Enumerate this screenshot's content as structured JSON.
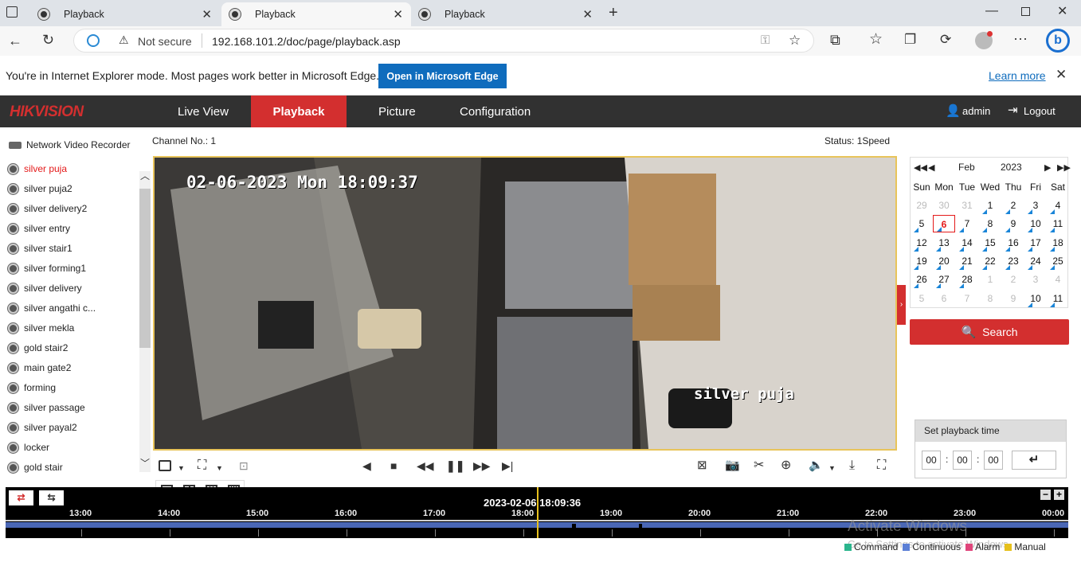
{
  "browser": {
    "tabs": [
      {
        "title": "Playback",
        "active": false
      },
      {
        "title": "Playback",
        "active": true
      },
      {
        "title": "Playback",
        "active": false
      }
    ],
    "security_label": "Not secure",
    "url": "192.168.101.2/doc/page/playback.asp",
    "ie_message": "You're in Internet Explorer mode. Most pages work better in Microsoft Edge.",
    "open_edge_label": "Open in Microsoft Edge",
    "learn_more_label": "Learn more"
  },
  "app": {
    "logo": "HIKVISION",
    "nav": [
      "Live View",
      "Playback",
      "Picture",
      "Configuration"
    ],
    "active_nav": "Playback",
    "user": "admin",
    "logout_label": "Logout"
  },
  "sidebar": {
    "title": "Network Video Recorder",
    "cameras": [
      "silver puja",
      "silver puja2",
      "silver delivery2",
      "silver entry",
      "silver stair1",
      "silver forming1",
      "silver delivery",
      "silver angathi c...",
      "silver mekla",
      "gold stair2",
      "main gate2",
      "forming",
      "silver passage",
      "silver payal2",
      "locker",
      "gold stair"
    ],
    "active_camera": "silver puja"
  },
  "player": {
    "channel": "Channel No.: 1",
    "status": "Status: 1Speed",
    "osd_time": "02-06-2023 Mon 18:09:37",
    "osd_name": "silver puja"
  },
  "calendar": {
    "month": "Feb",
    "year": "2023",
    "weekdays": [
      "Sun",
      "Mon",
      "Tue",
      "Wed",
      "Thu",
      "Fri",
      "Sat"
    ],
    "weeks": [
      [
        "29",
        "30",
        "31",
        "1",
        "2",
        "3",
        "4"
      ],
      [
        "5",
        "6",
        "7",
        "8",
        "9",
        "10",
        "11"
      ],
      [
        "12",
        "13",
        "14",
        "15",
        "16",
        "17",
        "18"
      ],
      [
        "19",
        "20",
        "21",
        "22",
        "23",
        "24",
        "25"
      ],
      [
        "26",
        "27",
        "28",
        "1",
        "2",
        "3",
        "4"
      ],
      [
        "5",
        "6",
        "7",
        "8",
        "9",
        "10",
        "11"
      ]
    ],
    "selected_day": "6",
    "search_label": "Search"
  },
  "playback_time": {
    "title": "Set playback time",
    "hh": "00",
    "mm": "00",
    "ss": "00"
  },
  "timeline": {
    "current": "2023-02-06 18:09:36",
    "ticks": [
      "13:00",
      "14:00",
      "15:00",
      "16:00",
      "17:00",
      "18:00",
      "19:00",
      "20:00",
      "21:00",
      "22:00",
      "23:00",
      "00:00"
    ]
  },
  "legend": [
    {
      "label": "Command",
      "color": "#2bb58d"
    },
    {
      "label": "Continuous",
      "color": "#5b7fd6"
    },
    {
      "label": "Alarm",
      "color": "#e0457b"
    },
    {
      "label": "Manual",
      "color": "#e6c01c"
    }
  ],
  "watermark": {
    "line1": "Activate Windows",
    "line2": "Go to Settings to activate Windows."
  },
  "colors": {
    "accent": "#d32f2f",
    "header": "#313131",
    "timeline_bar": "#4a67b5",
    "edge_blue": "#0f6cbd"
  }
}
